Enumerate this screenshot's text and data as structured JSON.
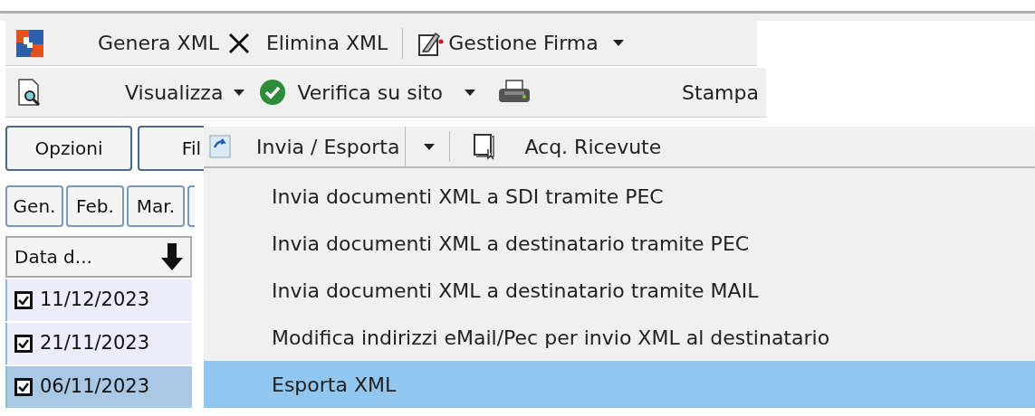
{
  "toolbar_1": {
    "items": [
      {
        "label": "Genera XML",
        "dropdown": false
      },
      {
        "label": "Elimina XML",
        "dropdown": false
      },
      {
        "label": "Gestione Firma",
        "dropdown": true
      }
    ]
  },
  "toolbar_2": {
    "items": [
      {
        "label": "Visualizza",
        "dropdown": true
      },
      {
        "label": "Verifica su sito",
        "dropdown": true
      },
      {
        "label": "Stampa",
        "dropdown": false
      }
    ]
  },
  "buttons": [
    {
      "label": "Opzioni"
    },
    {
      "label": "Fil"
    }
  ],
  "menu_bar": {
    "items": [
      {
        "label": "Invia / Esporta",
        "dropdown": true
      },
      {
        "label": "Acq. Ricevute",
        "dropdown": false
      }
    ]
  },
  "months": [
    {
      "label": "Gen."
    },
    {
      "label": "Feb."
    },
    {
      "label": "Mar."
    }
  ],
  "table": {
    "columns": [
      "Data d..."
    ],
    "rows": [
      {
        "checked": true,
        "date": "11/12/2023",
        "selected": false
      },
      {
        "checked": true,
        "date": "21/11/2023",
        "selected": false
      },
      {
        "checked": true,
        "date": "06/11/2023",
        "selected": true
      }
    ]
  },
  "menu": {
    "items": [
      {
        "label": "Invia documenti XML a SDI tramite PEC",
        "selected": false
      },
      {
        "label": "Invia documenti XML a destinatario tramite PEC",
        "selected": false
      },
      {
        "label": "Invia documenti XML a destinatario tramite MAIL",
        "selected": false
      },
      {
        "label": "Modifica indirizzi eMail/Pec per invio XML al destinatario",
        "selected": false
      },
      {
        "label": "Esporta XML",
        "selected": true
      }
    ]
  }
}
